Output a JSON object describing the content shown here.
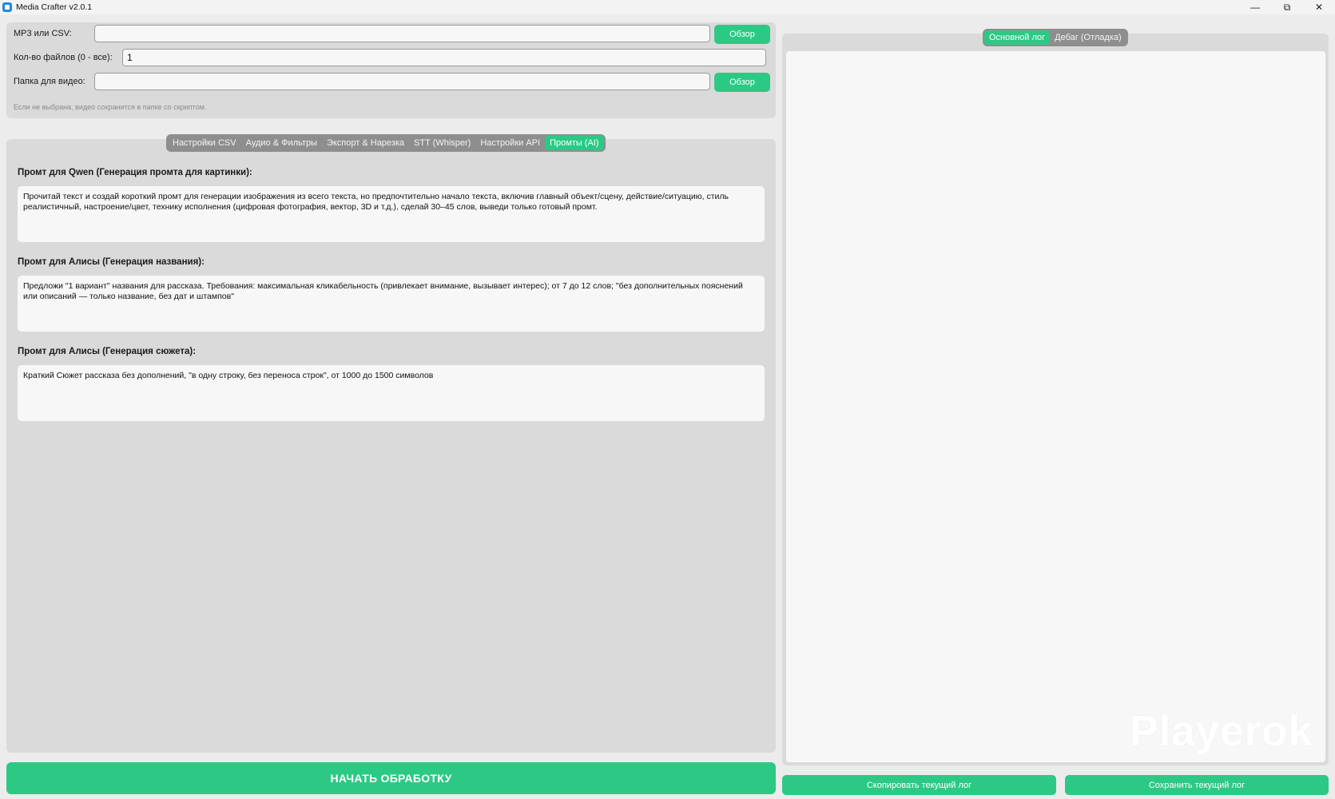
{
  "window": {
    "title": "Media Crafter v2.0.1",
    "minimize_icon": "minimize-icon",
    "maximize_icon": "restore-icon",
    "close_icon": "close-icon",
    "minimize_glyph": "—",
    "restore_glyph": "⧉",
    "close_glyph": "✕"
  },
  "inputs": {
    "mp3_csv_label": "MP3 или CSV:",
    "mp3_csv_value": "",
    "browse_label": "Обзор",
    "file_count_label": "Кол-во файлов (0 - все):",
    "file_count_value": "1",
    "video_folder_label": "Папка для видео:",
    "video_folder_value": "",
    "video_browse_label": "Обзор",
    "hint": "Если не выбрана, видео сохранится в папке со скриптом."
  },
  "settings_tabs": [
    {
      "label": "Настройки CSV",
      "active": false
    },
    {
      "label": "Аудио & Фильтры",
      "active": false
    },
    {
      "label": "Экспорт & Нарезка",
      "active": false
    },
    {
      "label": "STT (Whisper)",
      "active": false
    },
    {
      "label": "Настройки API",
      "active": false
    },
    {
      "label": "Промты (AI)",
      "active": true
    }
  ],
  "prompts": [
    {
      "label": "Промт для Qwen (Генерация промта для картинки):",
      "text": "Прочитай текст и создай короткий промт для генерации изображения из всего текста, но предпочтительно начало текста, включив главный объект/сцену, действие/ситуацию, стиль реалистичный, настроение/цвет, технику исполнения (цифровая фотография, вектор, 3D и т.д.), сделай 30–45 слов, выведи только готовый промт."
    },
    {
      "label": "Промт для Алисы (Генерация названия):",
      "text": "Предложи \"1 вариант\" названия для рассказа. Требования: максимальная кликабельность (привлекает внимание, вызывает интерес); от 7 до 12 слов; \"без дополнительных пояснений или описаний — только название, без дат и штампов\""
    },
    {
      "label": "Промт для Алисы (Генерация сюжета):",
      "text": "Краткий Сюжет рассказа без дополнений, \"в одну строку, без переноса строк\", от 1000 до 1500 символов"
    }
  ],
  "start_button": "НАЧАТЬ ОБРАБОТКУ",
  "log": {
    "tabs": [
      {
        "label": "Основной лог",
        "active": true
      },
      {
        "label": "Дебаг (Отладка)",
        "active": false
      }
    ],
    "content": "",
    "watermark": "Playerok",
    "copy_button": "Скопировать текущий лог",
    "save_button": "Сохранить текущий лог"
  },
  "colors": {
    "accent": "#2cc985",
    "panel": "#dadada",
    "background": "#ececec"
  }
}
